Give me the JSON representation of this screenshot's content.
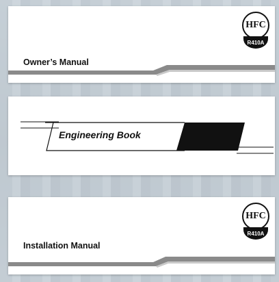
{
  "cards": [
    {
      "title": "Owner’s Manual",
      "badge_top": "HFC",
      "badge_bottom": "R410A"
    },
    {
      "title": "Engineering Book"
    },
    {
      "title": "Installation Manual",
      "badge_top": "HFC",
      "badge_bottom": "R410A"
    }
  ],
  "colors": {
    "card": "#ffffff",
    "stripe": "#8a8a8a",
    "dark": "#111111",
    "background": "#c9d2d9"
  }
}
